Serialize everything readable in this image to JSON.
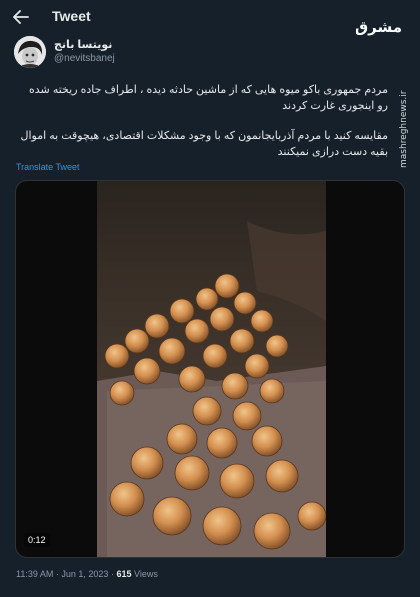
{
  "header": {
    "title": "Tweet",
    "back_icon": "arrow-left-icon"
  },
  "author": {
    "name": "نویتسا بانج",
    "handle": "@nevitsbanej"
  },
  "tweet": {
    "paragraph1": "مردم جمهوری باکو میوه هایی که از ماشین حادثه دیده ، اطراف جاده ریخته شده رو اینجوری غارت کردند",
    "paragraph2": "مقایسه کنید با مردم آذربایجانمون که با وجود مشکلات اقتصادی، هیچوقت به اموال بقیه دست درازی نمیکنند",
    "translate_label": "Translate Tweet"
  },
  "media": {
    "duration": "0:12"
  },
  "meta": {
    "time": "11:39 AM",
    "separator": "·",
    "date": "Jun 1, 2023",
    "views_count": "615",
    "views_label": "Views"
  },
  "branding": {
    "logo_text": "مشرق",
    "watermark_text": "mashreghnews.ir"
  },
  "colors": {
    "background": "#15202b",
    "link": "#1d9bf0",
    "muted": "#8b98a5"
  }
}
